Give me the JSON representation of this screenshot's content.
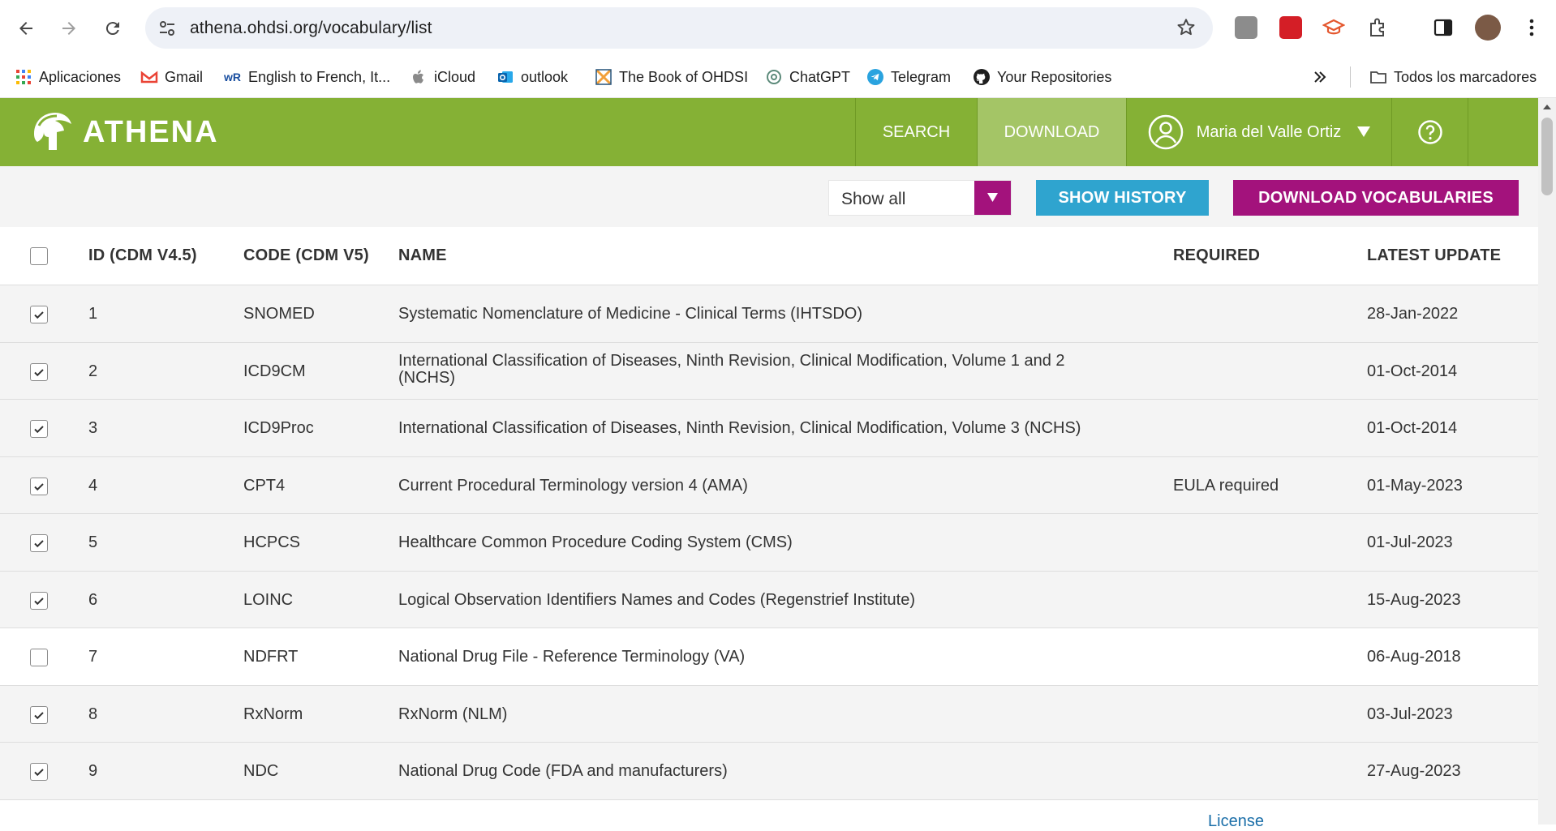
{
  "browser": {
    "url": "athena.ohdsi.org/vocabulary/list",
    "bookmarks": [
      {
        "label": "Aplicaciones",
        "icon": "apps-grid-icon"
      },
      {
        "label": "Gmail",
        "icon": "gmail-icon"
      },
      {
        "label": "English to French, It...",
        "icon": "wordreference-icon"
      },
      {
        "label": "iCloud",
        "icon": "apple-icon"
      },
      {
        "label": "outlook",
        "icon": "outlook-icon"
      },
      {
        "label": "The Book of OHDSI",
        "icon": "ohdsi-book-icon"
      },
      {
        "label": "ChatGPT",
        "icon": "chatgpt-icon"
      },
      {
        "label": "Telegram",
        "icon": "telegram-icon"
      },
      {
        "label": "Your Repositories",
        "icon": "github-icon"
      }
    ],
    "all_bookmarks": "Todos los marcadores"
  },
  "app": {
    "logo": "ATHENA",
    "nav": {
      "search": "SEARCH",
      "download": "DOWNLOAD",
      "user": "Maria del Valle Ortiz"
    },
    "colors": {
      "header_green": "#85b135",
      "active_tab": "#a4c566",
      "history_blue": "#2fa4cf",
      "download_magenta": "#a3127c"
    }
  },
  "filters": {
    "select_value": "Show all",
    "show_history": "SHOW HISTORY",
    "download_vocabularies": "DOWNLOAD VOCABULARIES"
  },
  "table": {
    "headers": {
      "id": "ID (CDM V4.5)",
      "code": "CODE (CDM V5)",
      "name": "NAME",
      "required": "REQUIRED",
      "latest_update": "LATEST UPDATE"
    },
    "rows": [
      {
        "checked": true,
        "id": "1",
        "code": "SNOMED",
        "name": "Systematic Nomenclature of Medicine - Clinical Terms (IHTSDO)",
        "required": "",
        "date": "28-Jan-2022"
      },
      {
        "checked": true,
        "id": "2",
        "code": "ICD9CM",
        "name": "International Classification of Diseases, Ninth Revision, Clinical Modification, Volume 1 and 2 (NCHS)",
        "required": "",
        "date": "01-Oct-2014"
      },
      {
        "checked": true,
        "id": "3",
        "code": "ICD9Proc",
        "name": "International Classification of Diseases, Ninth Revision, Clinical Modification, Volume 3 (NCHS)",
        "required": "",
        "date": "01-Oct-2014"
      },
      {
        "checked": true,
        "id": "4",
        "code": "CPT4",
        "name": "Current Procedural Terminology version 4 (AMA)",
        "required": "EULA required",
        "date": "01-May-2023"
      },
      {
        "checked": true,
        "id": "5",
        "code": "HCPCS",
        "name": "Healthcare Common Procedure Coding System (CMS)",
        "required": "",
        "date": "01-Jul-2023"
      },
      {
        "checked": true,
        "id": "6",
        "code": "LOINC",
        "name": "Logical Observation Identifiers Names and Codes (Regenstrief Institute)",
        "required": "",
        "date": "15-Aug-2023"
      },
      {
        "checked": false,
        "id": "7",
        "code": "NDFRT",
        "name": "National Drug File - Reference Terminology (VA)",
        "required": "",
        "date": "06-Aug-2018"
      },
      {
        "checked": true,
        "id": "8",
        "code": "RxNorm",
        "name": "RxNorm (NLM)",
        "required": "",
        "date": "03-Jul-2023"
      },
      {
        "checked": true,
        "id": "9",
        "code": "NDC",
        "name": "National Drug Code (FDA and manufacturers)",
        "required": "",
        "date": "27-Aug-2023"
      }
    ],
    "partial_next_required": "License"
  }
}
